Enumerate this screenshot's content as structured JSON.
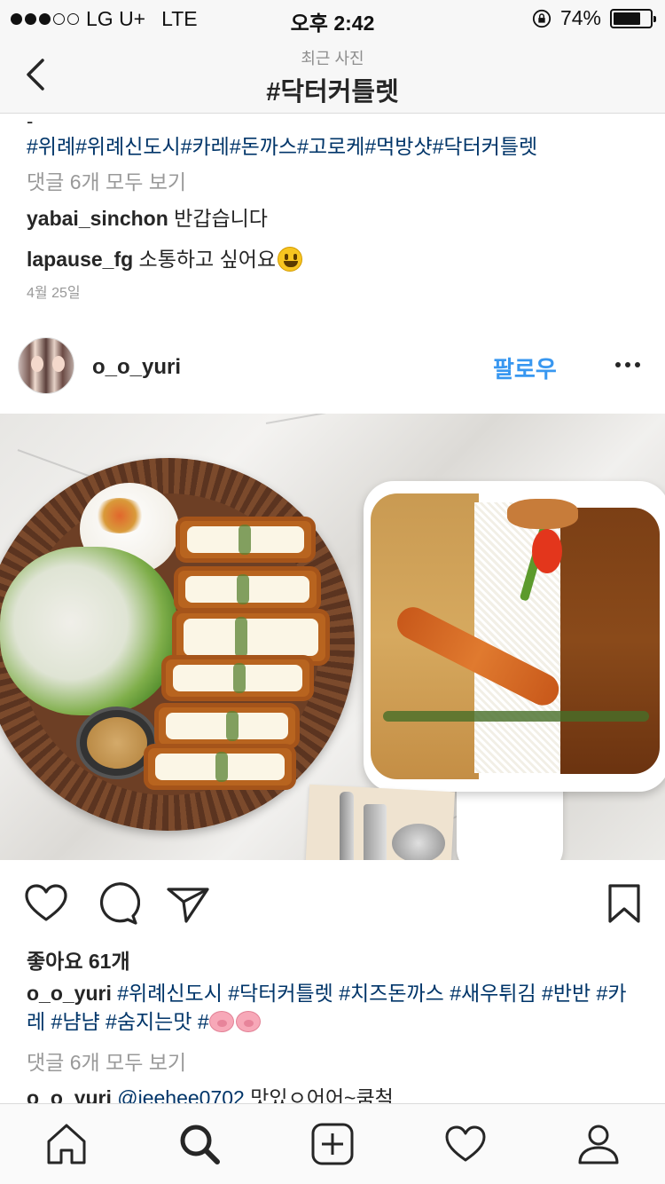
{
  "status_bar": {
    "carrier": "LG U+",
    "network": "LTE",
    "time": "오후 2:42",
    "battery_percent": "74%",
    "battery_level": 0.74,
    "signal_filled": 3,
    "signal_total": 5
  },
  "nav": {
    "subtitle": "최근 사진",
    "title": "#닥터커틀렛",
    "back_icon": "chevron-left-icon"
  },
  "prev_post": {
    "fragment": "-",
    "hashtags": "#위례#위례신도시#카레#돈까스#고로케#먹방샷#닥터커틀렛",
    "view_comments": "댓글 6개 모두 보기",
    "comments": [
      {
        "user": "yabai_sinchon",
        "text": "반갑습니다"
      },
      {
        "user": "lapause_fg",
        "text": "소통하고 싶어요"
      }
    ],
    "date": "4월 25일"
  },
  "post": {
    "username": "o_o_yuri",
    "follow_label": "팔로우",
    "likes": "좋아요 61개",
    "caption_user": "o_o_yuri",
    "caption_tags": "#위례신도시 #닥터커틀렛 #치즈돈까스 #새우튀김 #반반 #카레 #냠냠 #숨지는맛 #",
    "view_comments": "댓글 6개 모두 보기",
    "comment_preview": {
      "user": "o_o_yuri",
      "mention": "@jeehee0702",
      "text": "맛있ㅇ어어~쿰척"
    }
  },
  "icons": {
    "like": "heart-icon",
    "comment": "comment-icon",
    "share": "send-icon",
    "save": "bookmark-icon",
    "home": "home-icon",
    "search": "search-icon",
    "add": "add-icon",
    "activity": "heart-icon",
    "profile": "profile-icon"
  },
  "colors": {
    "link": "#003569",
    "follow": "#3897f0",
    "muted": "#999999",
    "text": "#262626"
  }
}
